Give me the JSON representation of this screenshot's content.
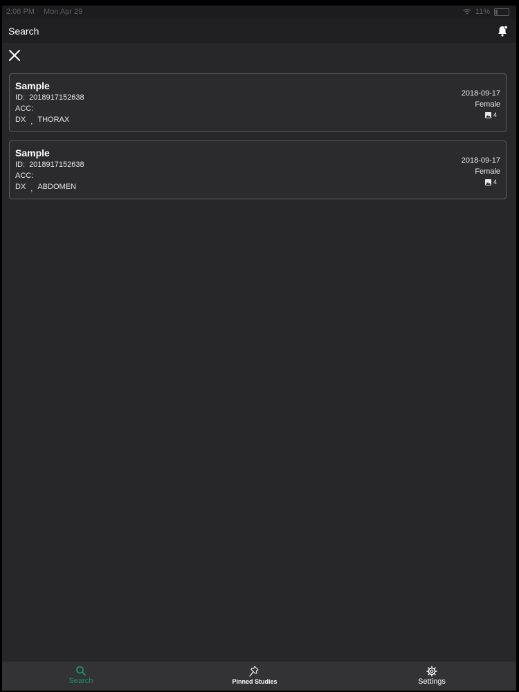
{
  "status_bar": {
    "time": "2:06 PM",
    "date": "Mon Apr 29",
    "battery": "11%"
  },
  "nav": {
    "title": "Search"
  },
  "results": [
    {
      "name": "Sample",
      "id_label": "ID:",
      "id": "2018917152638",
      "acc_label": "ACC:",
      "modality": "DX",
      "body_part": "THORAX",
      "date": "2018-09-17",
      "sex": "Female",
      "image_count": "4"
    },
    {
      "name": "Sample",
      "id_label": "ID:",
      "id": "2018917152638",
      "acc_label": "ACC:",
      "modality": "DX",
      "body_part": "ABDOMEN",
      "date": "2018-09-17",
      "sex": "Female",
      "image_count": "4"
    }
  ],
  "tabs": [
    {
      "label": "Search",
      "icon": "search-icon",
      "active": true
    },
    {
      "label": "Pinned Studies",
      "icon": "pin-icon",
      "active": false
    },
    {
      "label": "Settings",
      "icon": "gear-icon",
      "active": false
    }
  ],
  "colors": {
    "background": "#272729",
    "accent": "#1e8e6e",
    "card_border": "#5c5c60"
  }
}
